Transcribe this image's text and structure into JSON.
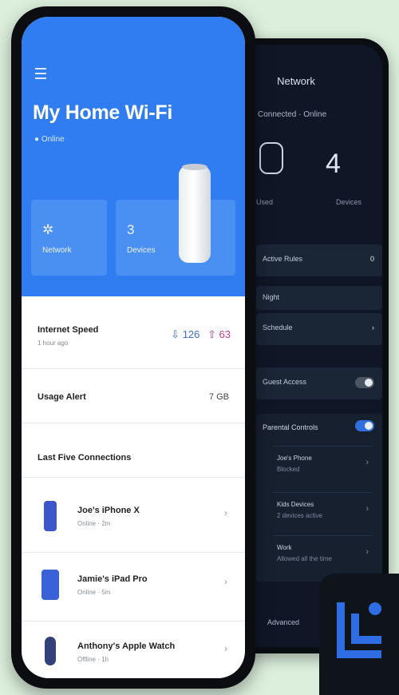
{
  "back_screen": {
    "title": "Network",
    "subtitle": "Connected · Online",
    "stat_label_1": "Used",
    "stat_big": "4",
    "stat_label_2": "Devices",
    "row_1": {
      "label": "Active Rules",
      "value": "0"
    },
    "row_2": {
      "label": "Night"
    },
    "row_3": {
      "label": "Schedule"
    },
    "row_4": {
      "label": "Guest Access"
    },
    "panel": {
      "head": "Parental Controls",
      "items": [
        {
          "title": "Joe's Phone",
          "sub": "Blocked"
        },
        {
          "title": "Kids Devices",
          "sub": "2 devices active"
        },
        {
          "title": "Work",
          "sub": "Allowed all the time"
        }
      ]
    },
    "bottom_text": "Advanced"
  },
  "front_screen": {
    "title": "My Home Wi-Fi",
    "subtitle": "Online",
    "card_1": {
      "icon": "settings-icon",
      "label": "Network"
    },
    "card_2": {
      "value": "3",
      "label": "Devices"
    },
    "internet": {
      "title": "Internet Speed",
      "sub": "1 hour ago",
      "down": "126",
      "up": "63"
    },
    "usage": {
      "title": "Usage Alert",
      "value": "7 GB"
    },
    "recent": {
      "title": "Last Five Connections"
    },
    "devices": [
      {
        "name": "Joe's iPhone X",
        "meta": "Online · 2m",
        "icon": "smartphone-icon"
      },
      {
        "name": "Jamie's iPad Pro",
        "meta": "Online · 5m",
        "icon": "tablet-icon"
      },
      {
        "name": "Anthony's Apple Watch",
        "meta": "Offline · 1h",
        "icon": "watch-icon"
      }
    ]
  }
}
